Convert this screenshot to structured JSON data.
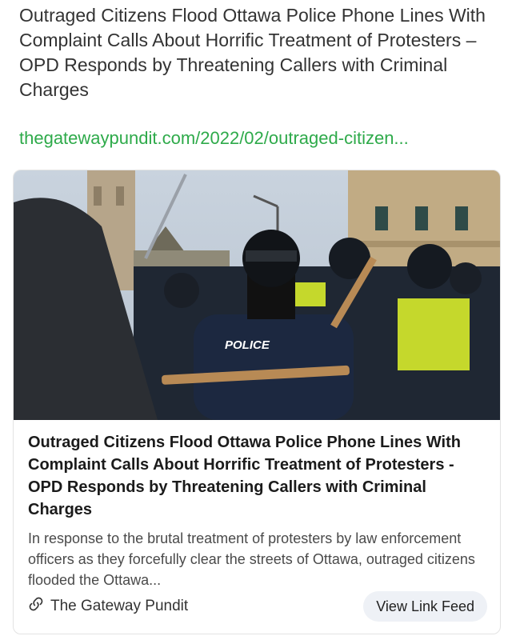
{
  "post": {
    "title": "Outraged Citizens Flood Ottawa Police Phone Lines With Complaint Calls About Horrific Treatment of Protesters – OPD Responds by Threatening Callers with Criminal Charges",
    "link_text": "thegatewaypundit.com/2022/02/outraged-citizen..."
  },
  "card": {
    "image_text": "POLICE",
    "title": "Outraged Citizens Flood Ottawa Police Phone Lines With Complaint Calls About Horrific Treatment of Protesters - OPD Responds by Threatening Callers with Criminal Charges",
    "description": "In response to the brutal treatment of protesters by law enforcement officers as they forcefully clear the streets of Ottawa, outraged citizens flooded the Ottawa...",
    "source_name": "The Gateway Pundit",
    "source_icon": "link-icon",
    "button_label": "View Link Feed"
  },
  "colors": {
    "link": "#2eaa4a",
    "button_bg": "#eef1f6"
  }
}
